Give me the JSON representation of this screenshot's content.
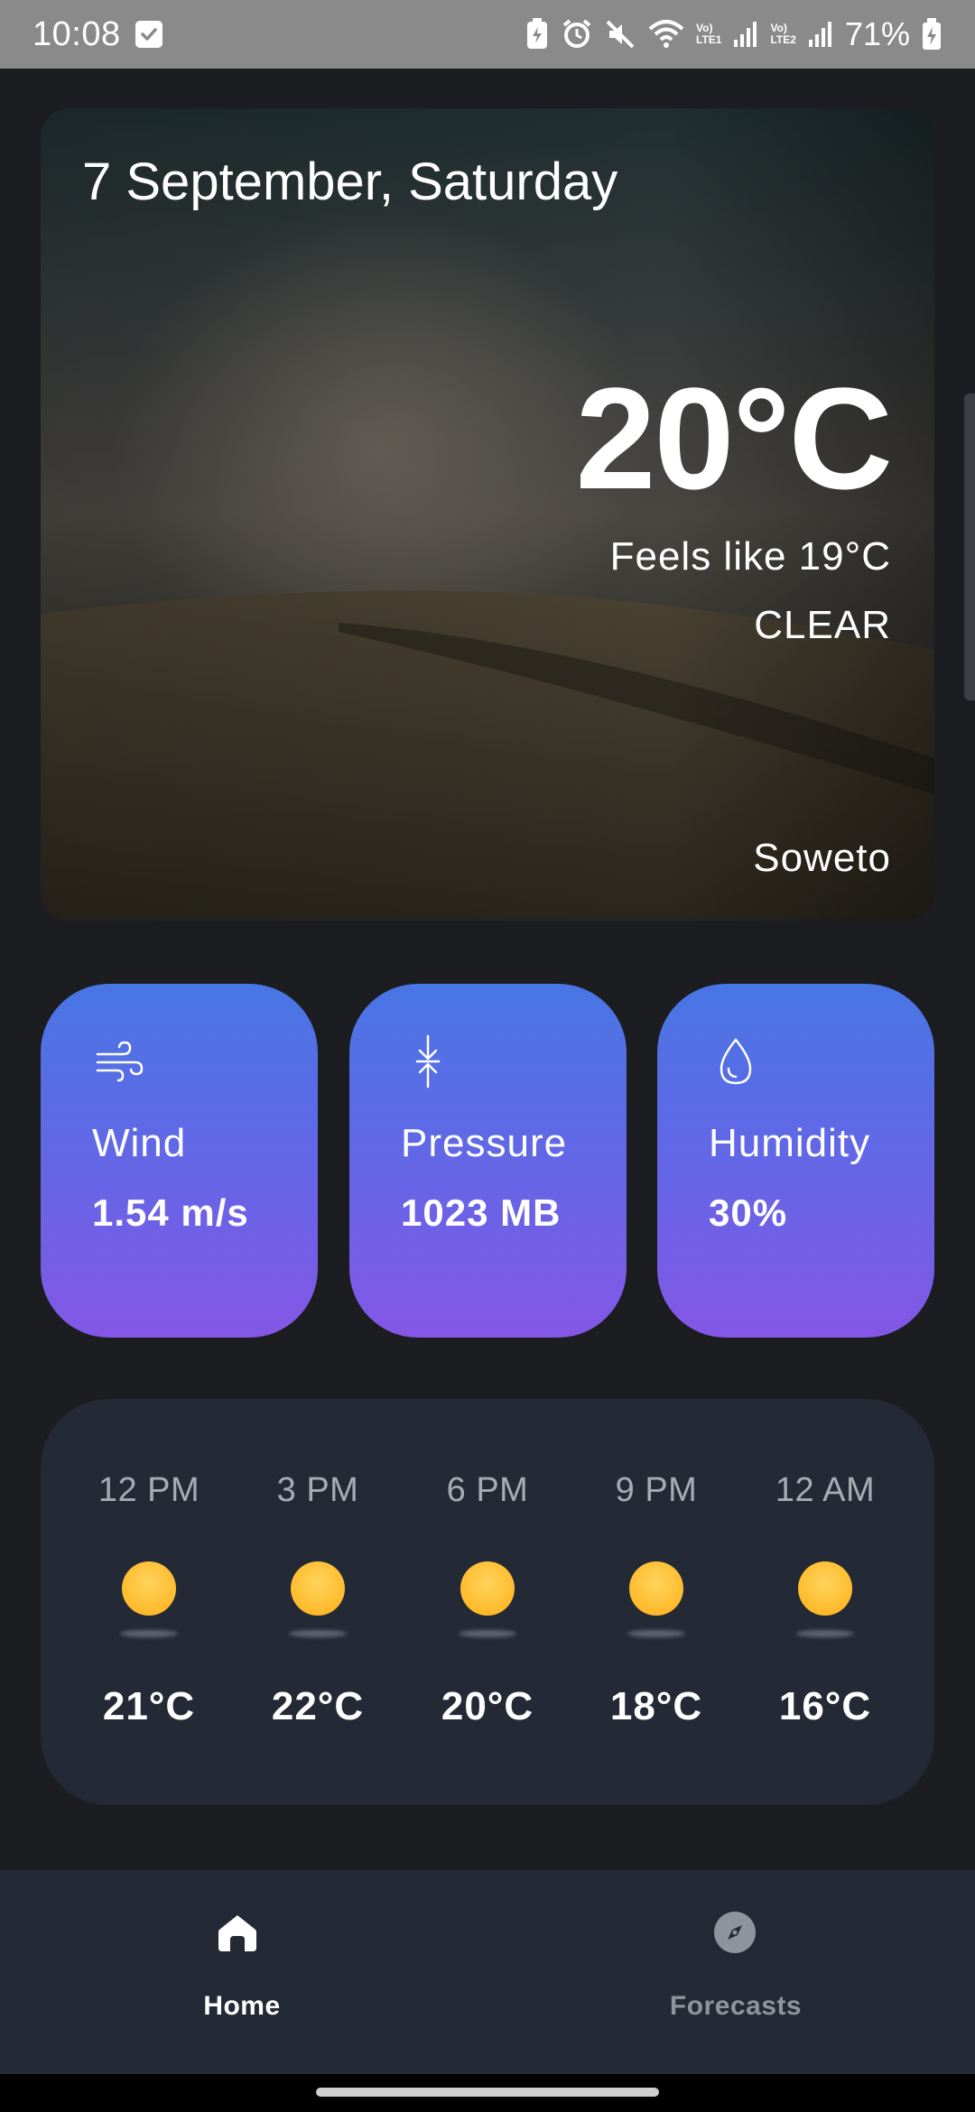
{
  "status_bar": {
    "time": "10:08",
    "battery": "71%",
    "sim1_tag_line1": "Vo)",
    "sim1_tag_line2": "LTE1",
    "sim2_tag_line1": "Vo)",
    "sim2_tag_line2": "LTE2"
  },
  "current": {
    "date": "7 September, Saturday",
    "temperature": "20°C",
    "feels_like": "Feels like 19°C",
    "condition": "CLEAR",
    "location": "Soweto"
  },
  "stats": [
    {
      "label": "Wind",
      "value": "1.54 m/s",
      "icon": "wind-icon"
    },
    {
      "label": "Pressure",
      "value": "1023 MB",
      "icon": "pressure-icon"
    },
    {
      "label": "Humidity",
      "value": "30%",
      "icon": "droplet-icon"
    }
  ],
  "hourly": [
    {
      "time": "12 PM",
      "temp": "21°C",
      "icon": "sun-icon"
    },
    {
      "time": "3 PM",
      "temp": "22°C",
      "icon": "sun-icon"
    },
    {
      "time": "6 PM",
      "temp": "20°C",
      "icon": "sun-icon"
    },
    {
      "time": "9 PM",
      "temp": "18°C",
      "icon": "sun-icon"
    },
    {
      "time": "12 AM",
      "temp": "16°C",
      "icon": "sun-icon"
    }
  ],
  "nav": {
    "items": [
      {
        "label": "Home",
        "icon": "home-icon",
        "active": true
      },
      {
        "label": "Forecasts",
        "icon": "compass-icon",
        "active": false
      }
    ]
  },
  "colors": {
    "background": "#1b1d21",
    "card_gradient_top": "#4876e4",
    "card_gradient_bottom": "#8457e6",
    "hourly_card": "#242a35",
    "sun": "#ffba2b"
  }
}
